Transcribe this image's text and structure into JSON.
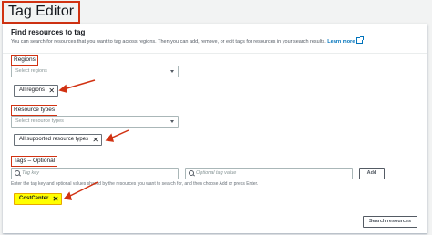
{
  "page": {
    "title": "Tag Editor"
  },
  "panel": {
    "title": "Find resources to tag",
    "description": "You can search for resources that you want to tag across regions. Then you can add, remove, or edit tags for resources in your search results.",
    "learn_more": "Learn more"
  },
  "regions": {
    "label": "Regions",
    "placeholder": "Select regions",
    "token": "All regions"
  },
  "resource_types": {
    "label": "Resource types",
    "placeholder": "Select resource types",
    "token": "All supported resource types"
  },
  "tags": {
    "label": "Tags – Optional",
    "key_placeholder": "Tag key",
    "value_placeholder": "Optional tag value",
    "add_label": "Add",
    "hint": "Enter the tag key and optional values shared by the resources you want to search for, and then choose Add or press Enter.",
    "token": "CostCenter"
  },
  "actions": {
    "search_label": "Search resources"
  },
  "icons": {
    "remove": "close-icon",
    "dropdown": "caret-down-icon",
    "search": "search-icon",
    "external": "external-link-icon",
    "annotation": "red-arrow-annotation"
  },
  "colors": {
    "annotation_red": "#d13212",
    "highlight_yellow": "#ffff00",
    "link_blue": "#0073bb"
  }
}
